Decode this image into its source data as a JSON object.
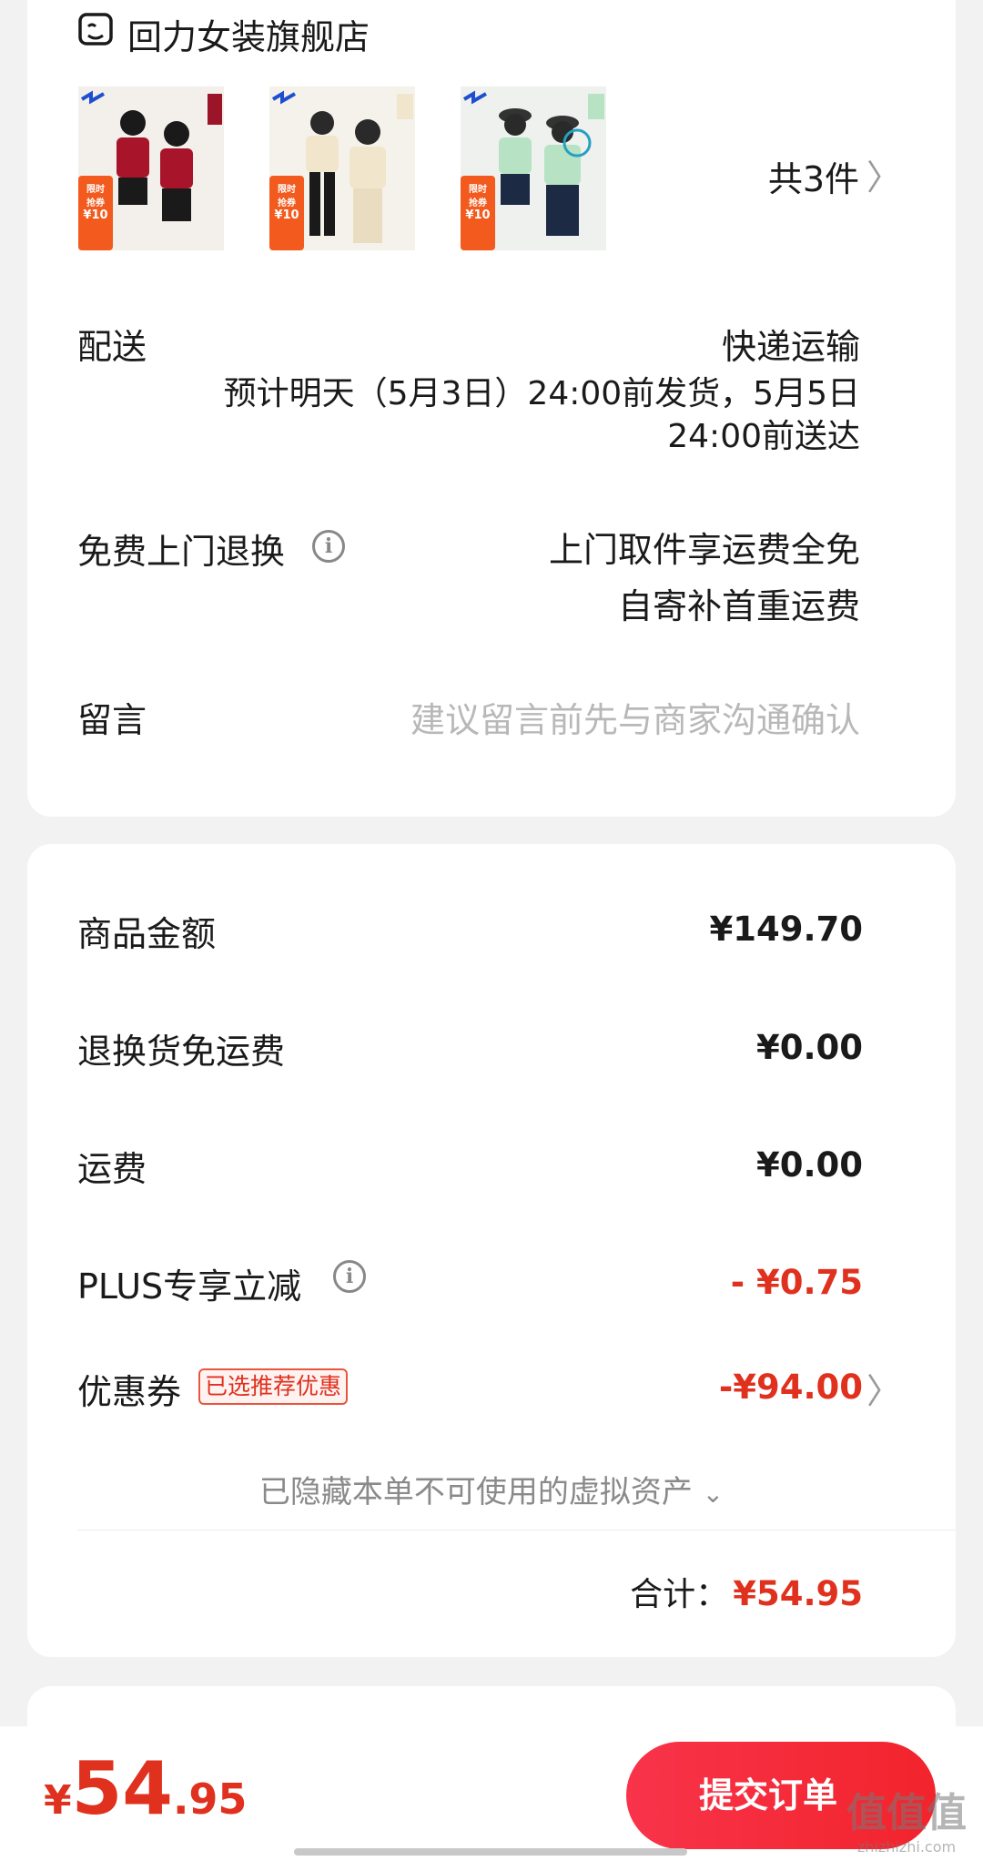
{
  "store": {
    "icon": "shop-icon",
    "name": "回力女装旗舰店"
  },
  "products": {
    "count_text": "共3件",
    "items": [
      {
        "promo_line1": "限时",
        "promo_line2": "抢券",
        "promo_price": "¥10",
        "shirt_color": "#a8142a"
      },
      {
        "promo_line1": "限时",
        "promo_line2": "抢券",
        "promo_price": "¥10",
        "shirt_color": "#f1e6cc"
      },
      {
        "promo_line1": "限时",
        "promo_line2": "抢券",
        "promo_price": "¥10",
        "shirt_color": "#b7e3c4"
      }
    ]
  },
  "delivery": {
    "label": "配送",
    "method": "快递运输",
    "eta_line1": "预计明天（5月3日）24:00前发货，5月5日",
    "eta_line2": "24:00前送达"
  },
  "returns": {
    "label": "免费上门退换",
    "line1": "上门取件享运费全免",
    "line2": "自寄补首重运费"
  },
  "message": {
    "label": "留言",
    "placeholder": "建议留言前先与商家沟通确认"
  },
  "summary": {
    "goods_label": "商品金额",
    "goods_value": "¥149.70",
    "return_ship_label": "退换货免运费",
    "return_ship_value": "¥0.00",
    "shipping_label": "运费",
    "shipping_value": "¥0.00",
    "plus_label": "PLUS专享立减",
    "plus_value": "- ¥0.75",
    "coupon_label": "优惠券",
    "coupon_tag": "已选推荐优惠",
    "coupon_value": "-¥94.00",
    "hidden_assets": "已隐藏本单不可使用的虚拟资产",
    "total_label": "合计：",
    "total_value": "¥54.95"
  },
  "footer": {
    "currency": "¥",
    "price_int": "54",
    "price_dec": ".95",
    "submit_label": "提交订单",
    "watermark": "值值值",
    "watermark_sub": "zhizhizhi.com"
  },
  "colors": {
    "accent_red": "#e0301e",
    "button_red": "#f2242c",
    "background": "#f2f2f2"
  }
}
